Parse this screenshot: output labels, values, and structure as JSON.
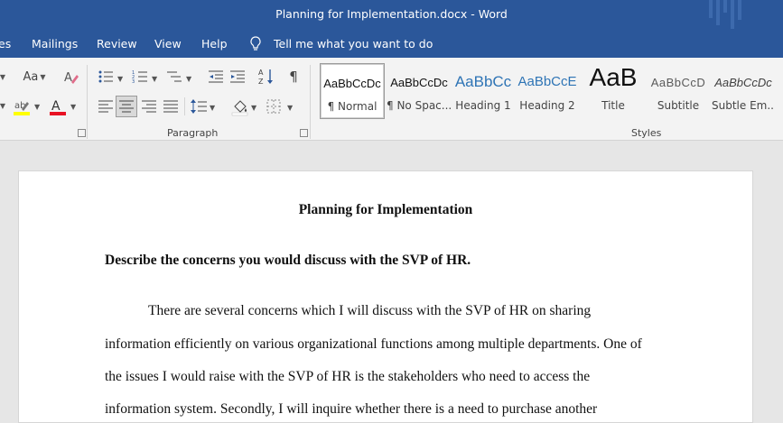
{
  "window": {
    "title": "Planning for Implementation.docx  -  Word"
  },
  "menu": {
    "items": [
      "es",
      "Mailings",
      "Review",
      "View",
      "Help"
    ],
    "tell_me": "Tell me what you want to do"
  },
  "ribbon": {
    "groups": {
      "paragraph": "Paragraph",
      "styles": "Styles"
    },
    "font_size_label": "Aa",
    "styles": [
      {
        "sample": "AaBbCcDc",
        "label": "¶ Normal"
      },
      {
        "sample": "AaBbCcDc",
        "label": "¶ No Spac..."
      },
      {
        "sample": "AaBbCc",
        "label": "Heading 1"
      },
      {
        "sample": "AaBbCcE",
        "label": "Heading 2"
      },
      {
        "sample": "AaB",
        "label": "Title"
      },
      {
        "sample": "AaBbCcD",
        "label": "Subtitle"
      },
      {
        "sample": "AaBbCcDc",
        "label": "Subtle Em..."
      }
    ],
    "colors": {
      "highlight": "#ffff00",
      "font_color": "#e81123",
      "accent": "#2b579a"
    }
  },
  "document": {
    "title": "Planning for Implementation",
    "heading": "Describe the concerns you would discuss with the SVP of HR.",
    "lines": [
      "There are several concerns which I will discuss with the SVP of HR on sharing",
      "information efficiently on various organizational functions among multiple departments. One of",
      "the issues I would raise with the SVP of HR is the stakeholders who need to access the",
      "information system. Secondly, I will inquire whether there is a need to purchase another"
    ]
  }
}
